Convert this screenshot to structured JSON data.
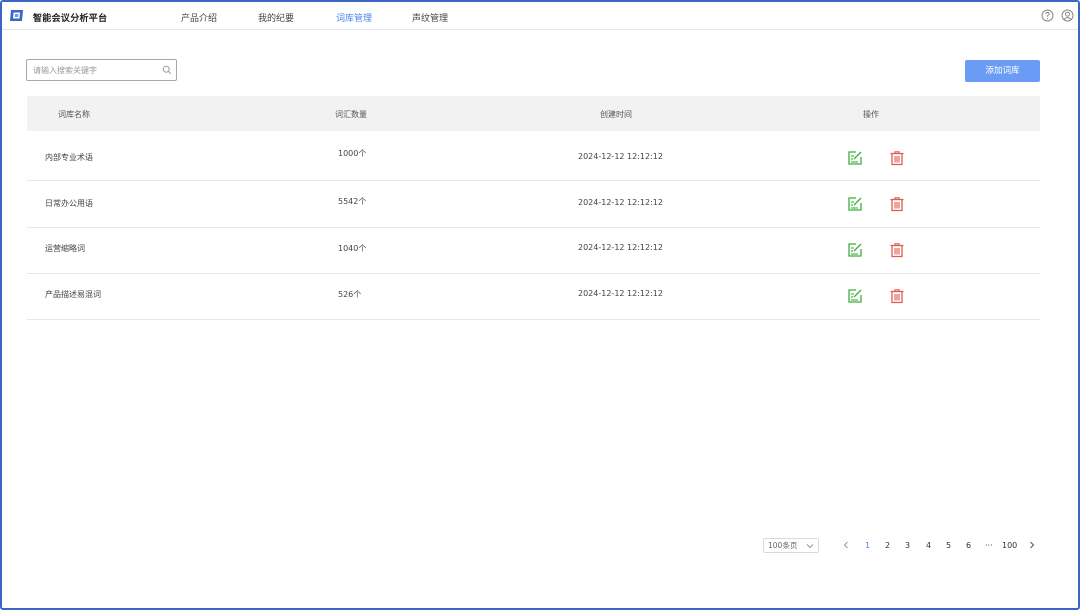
{
  "app": {
    "title": "智能会议分析平台",
    "brand_color": "#3b66c4",
    "accent_color": "#4a86e8"
  },
  "nav": {
    "items": [
      {
        "label": "产品介绍",
        "active": false
      },
      {
        "label": "我的纪要",
        "active": false
      },
      {
        "label": "词库管理",
        "active": true
      },
      {
        "label": "声纹管理",
        "active": false
      }
    ]
  },
  "header_icons": [
    "help-icon",
    "user-icon"
  ],
  "search": {
    "placeholder": "请输入搜索关键字",
    "value": ""
  },
  "toolbar": {
    "add_label": "添加词库"
  },
  "table": {
    "columns": [
      "词库名称",
      "词汇数量",
      "创建时间",
      "操作"
    ],
    "rows": [
      {
        "name": "内部专业术语",
        "count": "1000个",
        "created": "2024-12-12 12:12:12"
      },
      {
        "name": "日常办公用语",
        "count": "5542个",
        "created": "2024-12-12 12:12:12"
      },
      {
        "name": "运营缩略词",
        "count": "1040个",
        "created": "2024-12-12 12:12:12"
      },
      {
        "name": "产品描述易混词",
        "count": "526个",
        "created": "2024-12-12 12:12:12"
      }
    ],
    "edit_color": "#3fae3f",
    "delete_color": "#e05a4f"
  },
  "pagination": {
    "page_size": "100条页",
    "pages": [
      "1",
      "2",
      "3",
      "4",
      "5",
      "6"
    ],
    "ellipsis": "···",
    "last_page": "100",
    "current": "1"
  }
}
